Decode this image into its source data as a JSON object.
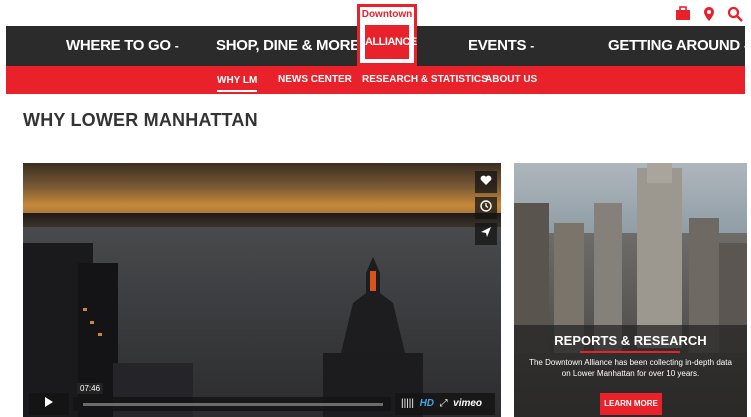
{
  "utility_icons": [
    "briefcase-icon",
    "map-pin-icon",
    "search-icon"
  ],
  "brand": {
    "top": "Downtown",
    "box": "ALLIANCE",
    "accent": "#e8212a"
  },
  "main_nav": [
    {
      "label": "WHERE TO GO",
      "caret": "-"
    },
    {
      "label": "SHOP, DINE & MORE",
      "caret": "-"
    },
    {
      "label": "EVENTS",
      "caret": "-"
    },
    {
      "label": "GETTING AROUND",
      "caret": "-"
    }
  ],
  "sub_nav": [
    {
      "label": "WHY LM",
      "active": true
    },
    {
      "label": "NEWS CENTER"
    },
    {
      "label": "RESEARCH & STATISTICS"
    },
    {
      "label": "ABOUT US"
    }
  ],
  "page": {
    "title": "WHY LOWER MANHATTAN"
  },
  "video": {
    "time": "07:46",
    "hd": "HD",
    "brand": "vimeo"
  },
  "card": {
    "title": "REPORTS & RESEARCH",
    "text": "The Downtown Alliance has been collecting in-depth data on Lower Manhattan for over 10 years.",
    "button": "LEARN MORE"
  }
}
